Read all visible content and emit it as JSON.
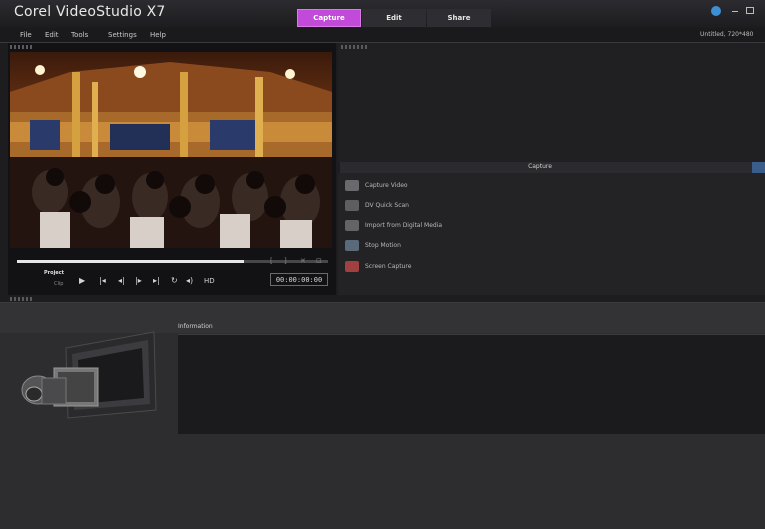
{
  "app": {
    "title": "Corel VideoStudio X7",
    "project": "Untitled, 720*480"
  },
  "tabs": [
    {
      "label": "Capture"
    },
    {
      "label": "Edit"
    },
    {
      "label": "Share"
    }
  ],
  "menu": [
    {
      "label": "File"
    },
    {
      "label": "Edit"
    },
    {
      "label": "Tools"
    },
    {
      "label": "Settings"
    },
    {
      "label": "Help"
    }
  ],
  "player": {
    "mode_project": "Project",
    "mode_clip": "Clip",
    "timecode": "00:00:00:00",
    "progress": 0.73,
    "controls": [
      "play-icon",
      "home-icon",
      "previous-frame-icon",
      "next-frame-icon",
      "end-icon",
      "repeat-icon",
      "volume-icon",
      "hd-icon"
    ],
    "hd_label": "HD"
  },
  "capture": {
    "title": "Capture",
    "items": [
      {
        "label": "Capture Video",
        "icon": "camcorder-icon"
      },
      {
        "label": "DV Quick Scan",
        "icon": "dv-scan-icon"
      },
      {
        "label": "Import from Digital Media",
        "icon": "import-media-icon"
      },
      {
        "label": "Stop Motion",
        "icon": "stop-motion-icon"
      },
      {
        "label": "Screen Capture",
        "icon": "screen-capture-icon"
      }
    ]
  },
  "info": {
    "label": "Information"
  },
  "colors": {
    "accent": "#c14ad8",
    "background": "#1d1d1f"
  }
}
